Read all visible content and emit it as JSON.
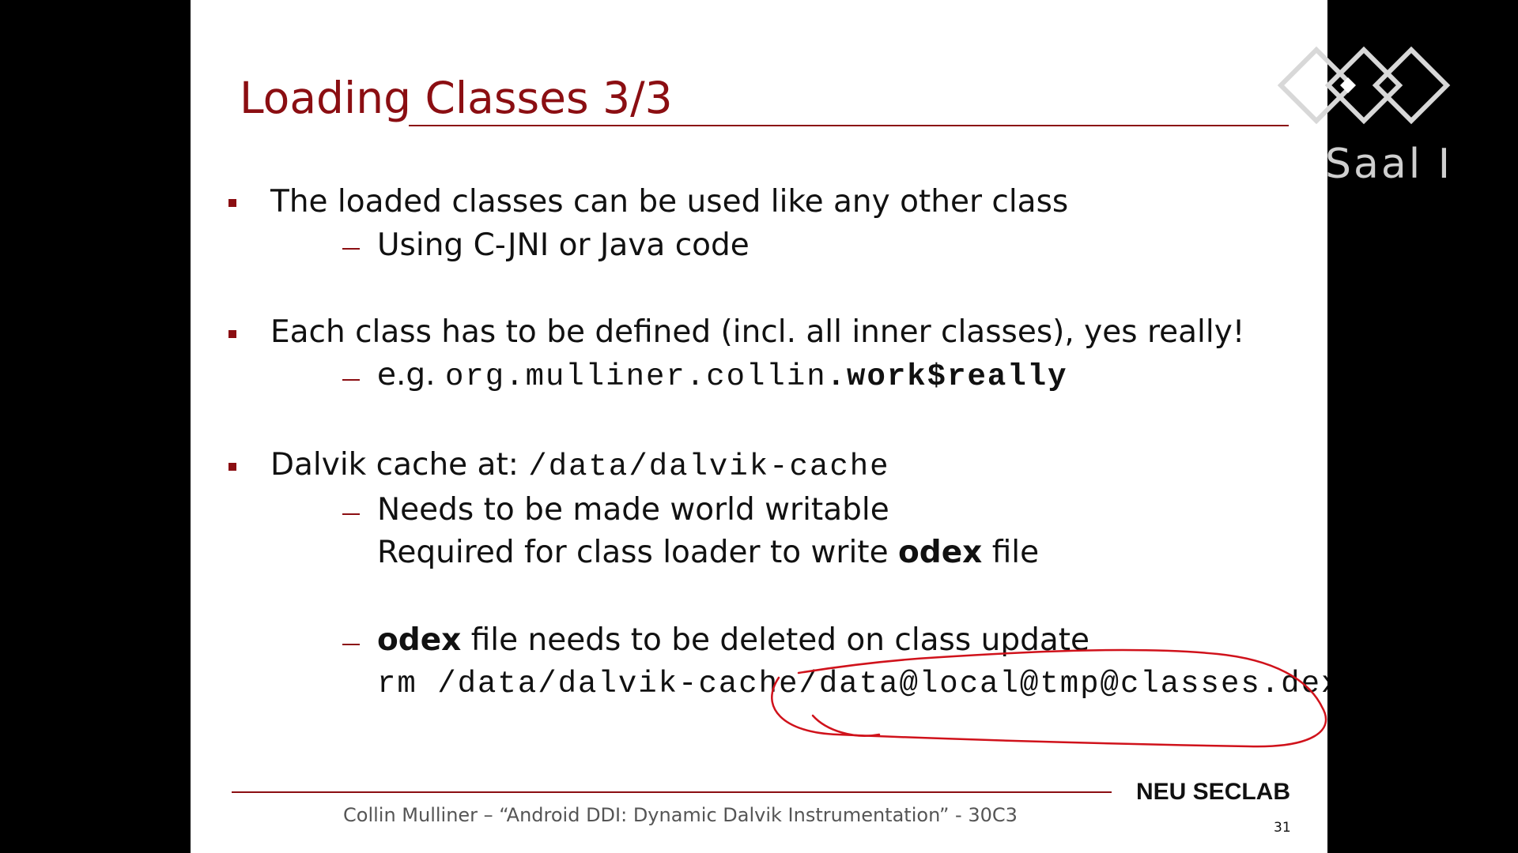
{
  "slide": {
    "title": "Loading Classes 3/3",
    "bullets": [
      {
        "text": "The loaded classes can be used like any other class",
        "sub": [
          "Using C-JNI or Java code"
        ]
      },
      {
        "text": "Each class has to be defined (incl. all inner classes), yes really!",
        "sub_prefix": "e.g. ",
        "sub_code": "org.mulliner.collin",
        "sub_code_bold": ".work$really"
      },
      {
        "text": "Dalvik cache at: ",
        "code": "/data/dalvik-cache",
        "sub1_line1": "Needs to be made world writable",
        "sub1_line2_pre": "Required for class loader to write ",
        "sub1_line2_bold": "odex",
        "sub1_line2_post": " file",
        "sub2_bold": "odex",
        "sub2_text": " file needs to be deleted on class update",
        "sub2_code": "rm /data/dalvik-cache/data@local@tmp@classes.dex"
      }
    ],
    "footer": "Collin Mulliner –  “Android DDI: Dynamic Dalvik Instrumentation”  -  30C3",
    "lab": "NEU SECLAB",
    "page": "31"
  },
  "logo": {
    "text": "Saal I",
    "icon": "30c3-logo-icon"
  },
  "colors": {
    "accent": "#8b0e12",
    "annotation": "#d0121b",
    "background": "#000000"
  }
}
